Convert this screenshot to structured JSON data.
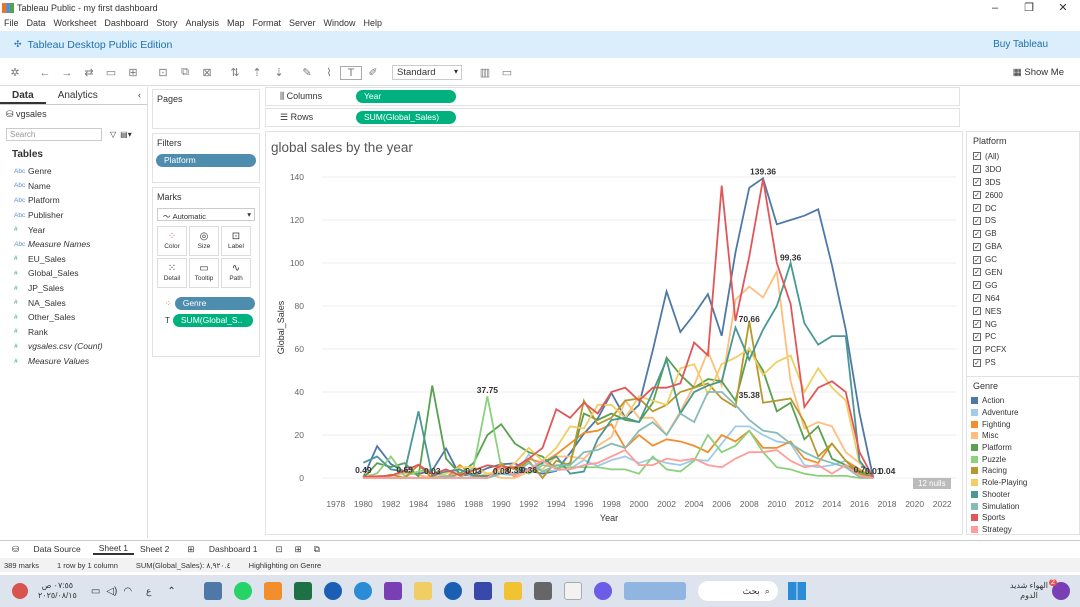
{
  "window": {
    "title": "Tableau Public - my first dashboard"
  },
  "menu": [
    "File",
    "Data",
    "Worksheet",
    "Dashboard",
    "Story",
    "Analysis",
    "Map",
    "Format",
    "Server",
    "Window",
    "Help"
  ],
  "brand": {
    "edition": "Tableau Desktop Public Edition",
    "buy": "Buy Tableau"
  },
  "toolbar": {
    "fit": "Standard",
    "show_me": "Show Me"
  },
  "left": {
    "tab_data": "Data",
    "tab_analytics": "Analytics",
    "source": "vgsales",
    "search_placeholder": "Search",
    "tables": "Tables",
    "fields": [
      {
        "t": "Abc",
        "n": "Genre"
      },
      {
        "t": "Abc",
        "n": "Name"
      },
      {
        "t": "Abc",
        "n": "Platform"
      },
      {
        "t": "Abc",
        "n": "Publisher"
      },
      {
        "t": "#",
        "n": "Year"
      },
      {
        "t": "Abc",
        "n": "Measure Names",
        "it": true
      },
      {
        "t": "#",
        "n": "EU_Sales"
      },
      {
        "t": "#",
        "n": "Global_Sales"
      },
      {
        "t": "#",
        "n": "JP_Sales"
      },
      {
        "t": "#",
        "n": "NA_Sales"
      },
      {
        "t": "#",
        "n": "Other_Sales"
      },
      {
        "t": "#",
        "n": "Rank"
      },
      {
        "t": "#",
        "n": "vgsales.csv (Count)",
        "it": true
      },
      {
        "t": "#",
        "n": "Measure Values",
        "it": true
      }
    ]
  },
  "pages": "Pages",
  "filters": {
    "title": "Filters",
    "pill": "Platform"
  },
  "marks": {
    "title": "Marks",
    "type": "Automatic",
    "buttons": [
      "Color",
      "Size",
      "Label",
      "Detail",
      "Tooltip",
      "Path"
    ],
    "pill1": "Genre",
    "pill2": "SUM(Global_S.."
  },
  "shelves": {
    "columns_label": "Columns",
    "columns": "Year",
    "rows_label": "Rows",
    "rows": "SUM(Global_Sales)"
  },
  "chart_data": {
    "type": "line",
    "title": "global sales by the year",
    "xlabel": "Year",
    "ylabel": "Global_Sales",
    "ylim": [
      0,
      140
    ],
    "xticks": [
      "1978",
      "1980",
      "1982",
      "1984",
      "1986",
      "1988",
      "1990",
      "1992",
      "1994",
      "1996",
      "1998",
      "2000",
      "2002",
      "2004",
      "2006",
      "2008",
      "2010",
      "2012",
      "2014",
      "2016",
      "2018",
      "2020",
      "2022"
    ],
    "yticks": [
      "0",
      "20",
      "40",
      "60",
      "80",
      "100",
      "120",
      "140"
    ],
    "x": [
      1980,
      1981,
      1982,
      1983,
      1984,
      1985,
      1986,
      1987,
      1988,
      1989,
      1990,
      1991,
      1992,
      1993,
      1994,
      1995,
      1996,
      1997,
      1998,
      1999,
      2000,
      2001,
      2002,
      2003,
      2004,
      2005,
      2006,
      2007,
      2008,
      2009,
      2010,
      2011,
      2012,
      2013,
      2014,
      2015,
      2016,
      2017
    ],
    "series": [
      {
        "name": "Action",
        "color": "#4e79a7",
        "values": [
          0.3,
          14.8,
          6.5,
          2.9,
          1.9,
          3.5,
          13.7,
          1.1,
          1.7,
          4.6,
          6.4,
          6.8,
          3.5,
          2,
          3.3,
          11.6,
          20.6,
          27.6,
          39.5,
          28,
          34,
          59.4,
          86.8,
          67.9,
          76.1,
          85.5,
          66.1,
          104.9,
          135,
          139.4,
          118,
          120,
          122,
          125,
          99,
          69,
          30,
          0
        ]
      },
      {
        "name": "Adventure",
        "color": "#a0cbe8",
        "values": [
          0,
          0,
          0,
          0.4,
          0,
          0,
          0,
          4,
          0.2,
          0,
          2,
          1.1,
          11,
          2.8,
          3.6,
          4.2,
          8.4,
          5.6,
          8.3,
          10,
          7,
          9,
          7,
          6,
          8.5,
          8,
          16,
          24,
          24,
          20,
          17,
          16,
          6,
          5,
          6,
          8,
          4,
          0
        ]
      },
      {
        "name": "Fighting",
        "color": "#f28e2b",
        "values": [
          0.8,
          0,
          0,
          0,
          0,
          1,
          0,
          6,
          1,
          0,
          7,
          0.4,
          9,
          7,
          11,
          16,
          21,
          22,
          25,
          14,
          20,
          15,
          18,
          17,
          15,
          12,
          20,
          17,
          22,
          14,
          14,
          17,
          9,
          7,
          16,
          8,
          4,
          0
        ]
      },
      {
        "name": "Misc",
        "color": "#ffbe7d",
        "values": [
          2.7,
          0,
          0.9,
          2.1,
          1.5,
          0,
          0,
          0,
          0.3,
          2,
          0,
          0,
          3,
          4,
          10,
          10,
          9,
          15,
          19,
          36,
          28,
          28,
          20,
          31,
          43,
          59,
          43,
          83,
          89,
          84,
          96,
          45,
          23,
          26,
          24,
          12,
          7,
          0
        ]
      },
      {
        "name": "Platform",
        "color": "#59a14f",
        "values": [
          0,
          6.9,
          5.1,
          6.9,
          0.7,
          43,
          9,
          2,
          7,
          20,
          25,
          16,
          12,
          10,
          4,
          7,
          30,
          27,
          30,
          27,
          26,
          35,
          56,
          48,
          42,
          46,
          45,
          36,
          60,
          50,
          31,
          35,
          18,
          24,
          9,
          6,
          3,
          0
        ]
      },
      {
        "name": "Puzzle",
        "color": "#8cd17d",
        "values": [
          0,
          2.2,
          10,
          0.8,
          3.1,
          4,
          0,
          0,
          5,
          38,
          5,
          5,
          2,
          6,
          5,
          5,
          5,
          5,
          4,
          4,
          2,
          10,
          4,
          3,
          8,
          20,
          12,
          15,
          22,
          12,
          5,
          4,
          2,
          1,
          1,
          1,
          0,
          0
        ]
      },
      {
        "name": "Racing",
        "color": "#b6992d",
        "values": [
          0,
          0,
          1.6,
          0,
          6,
          0,
          0,
          2,
          2,
          0,
          6,
          4,
          8,
          0,
          8,
          6,
          36,
          25,
          28,
          36,
          37,
          31,
          34,
          40,
          42,
          44,
          37,
          33,
          73,
          35,
          36,
          37,
          26,
          10,
          16,
          8,
          2,
          0
        ]
      },
      {
        "name": "Role-Playing",
        "color": "#f1ce63",
        "values": [
          0,
          0,
          0,
          0,
          0,
          0,
          2,
          5,
          5,
          2,
          3,
          7,
          14,
          8,
          14,
          24,
          23,
          34,
          34,
          28,
          38,
          36,
          34,
          51,
          53,
          39,
          53,
          56,
          60,
          48,
          54,
          57,
          40,
          51,
          42,
          36,
          7,
          0
        ]
      },
      {
        "name": "Shooter",
        "color": "#499894",
        "values": [
          7.1,
          10,
          4,
          3,
          31,
          1,
          3,
          4,
          1,
          1,
          2,
          2,
          4,
          7,
          10,
          2,
          3,
          18,
          27,
          28,
          26,
          40,
          55,
          30,
          40,
          43,
          45,
          70,
          55,
          69,
          80,
          100,
          72,
          62,
          66,
          66,
          8,
          0
        ]
      },
      {
        "name": "Simulation",
        "color": "#86bcb6",
        "values": [
          0,
          0.5,
          0,
          0,
          0,
          0,
          1,
          0,
          0.2,
          0,
          2,
          2,
          7,
          3,
          6,
          6,
          12,
          13,
          16,
          14,
          22,
          26,
          20,
          30,
          26,
          40,
          40,
          34,
          27,
          22,
          21,
          16,
          12,
          9,
          7,
          5,
          0.5,
          0
        ]
      },
      {
        "name": "Sports",
        "color": "#e15759",
        "values": [
          0.5,
          0.8,
          1.1,
          3.3,
          6.2,
          1.7,
          4,
          1.2,
          3.6,
          5.9,
          5,
          5,
          9,
          14,
          32,
          28,
          35,
          30,
          40,
          42,
          36,
          42,
          42,
          44,
          63,
          57,
          136,
          73,
          103,
          139,
          100,
          81,
          33,
          42,
          45,
          40,
          12,
          0
        ]
      },
      {
        "name": "Strategy",
        "color": "#ff9d9a",
        "values": [
          0,
          0,
          0,
          0,
          0,
          0,
          0,
          0,
          0,
          0,
          5,
          1,
          4,
          8,
          4,
          4,
          6,
          7,
          10,
          13,
          6,
          6,
          9,
          8,
          9,
          6,
          5,
          9,
          12,
          12,
          13,
          8,
          5,
          6,
          2,
          6,
          1,
          0
        ]
      }
    ],
    "data_labels": [
      {
        "text": "139.36",
        "x": 2009,
        "y": 139.36
      },
      {
        "text": "99.36",
        "x": 2011,
        "y": 99.36
      },
      {
        "text": "70.66",
        "x": 2008,
        "y": 70.66
      },
      {
        "text": "35.38",
        "x": 2008,
        "y": 35.38
      },
      {
        "text": "37.75",
        "x": 1989,
        "y": 37.75
      },
      {
        "text": "0.49",
        "x": 1980,
        "y": 0.49
      },
      {
        "text": "0.69",
        "x": 1983,
        "y": 0.69
      },
      {
        "text": "0.03",
        "x": 1985,
        "y": 0.03
      },
      {
        "text": "0.03",
        "x": 1988,
        "y": 0.03
      },
      {
        "text": "0.08",
        "x": 1990,
        "y": 0.08
      },
      {
        "text": "0.39",
        "x": 1991,
        "y": 0.39
      },
      {
        "text": "0.36",
        "x": 1992,
        "y": 0.36
      },
      {
        "text": "0.7",
        "x": 2016,
        "y": 0.7
      },
      {
        "text": "0.01",
        "x": 2017,
        "y": 0.01
      },
      {
        "text": "0.04",
        "x": 2018,
        "y": 0.04
      }
    ],
    "nulls": "12 nulls"
  },
  "platform_filter": {
    "title": "Platform",
    "items": [
      "(All)",
      "3DO",
      "3DS",
      "2600",
      "DC",
      "DS",
      "GB",
      "GBA",
      "GC",
      "GEN",
      "GG",
      "N64",
      "NES",
      "NG",
      "PC",
      "PCFX",
      "PS"
    ]
  },
  "genre_legend": {
    "title": "Genre"
  },
  "sheets": {
    "data_source": "Data Source",
    "tabs": [
      "Sheet 1",
      "Sheet 2",
      "Dashboard 1"
    ]
  },
  "status": {
    "marks": "389 marks",
    "rows": "1 row by 1 column",
    "sum": "SUM(Global_Sales): ٨,٩٢٠.٤",
    "highlight": "Highlighting on Genre"
  },
  "taskbar": {
    "search": "بحث",
    "weather": "الهواء شديد",
    "weather2": "الدوم",
    "time": "٠٧:٥٥ ص",
    "date": "٢٠٢٥/٠٨/١٥",
    "lang": "ع",
    "badge": "2"
  }
}
